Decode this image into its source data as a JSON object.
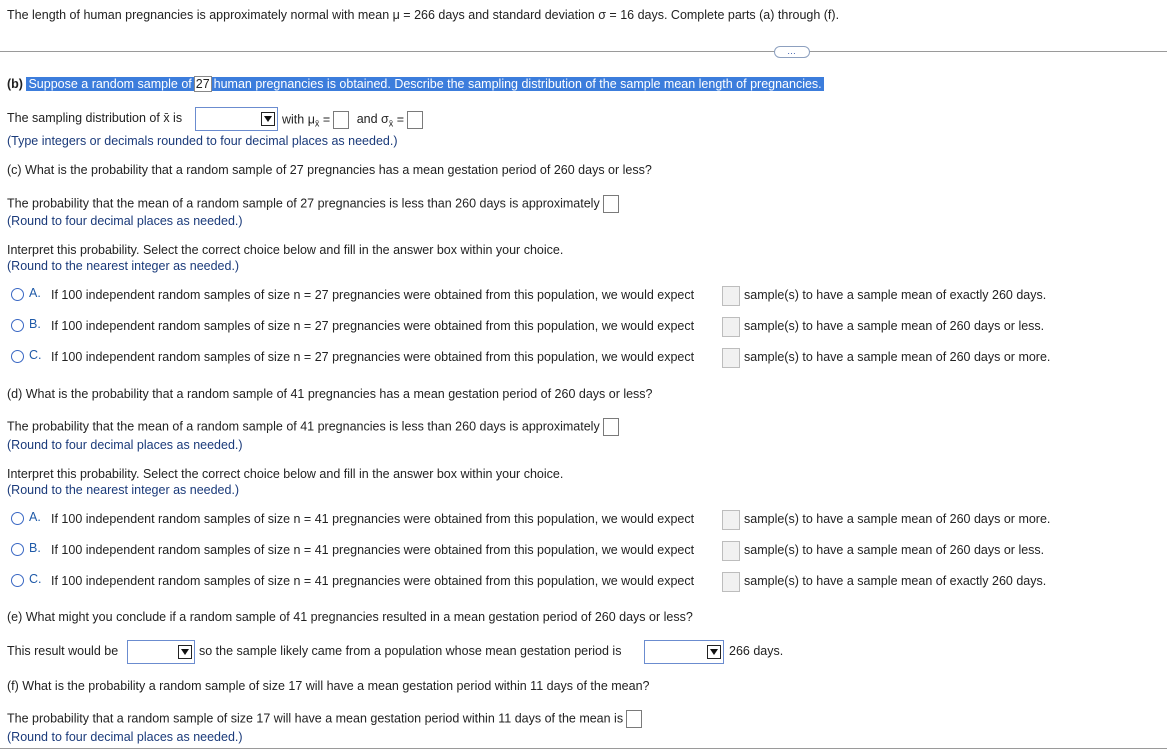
{
  "header": {
    "text": "The length of human pregnancies is approximately normal with mean μ = 266 days and standard deviation σ = 16 days. Complete parts (a) through (f)."
  },
  "more_button": {
    "label": "…"
  },
  "part_b": {
    "label": "(b)",
    "q1": "Suppose a random sample of",
    "n": "27",
    "q2": "human pregnancies is obtained. Describe the sampling distribution of the sample mean length of pregnancies.",
    "line_prefix": "The sampling distribution of x̄ is",
    "with_mu": "with μ",
    "x_bar_sub": "x̄",
    "equals": "=",
    "and_sigma": "and σ",
    "note": "(Type integers or decimals rounded to four decimal places as needed.)"
  },
  "part_c": {
    "question": "(c) What is the probability that a random sample of 27 pregnancies has a mean gestation period of 260 days or less?",
    "answer_text": "The probability that the mean of a random sample of 27 pregnancies is less than 260 days is approximately",
    "note": "(Round to four decimal places as needed.)",
    "interpret": "Interpret this probability. Select the correct choice below and fill in the answer box within your choice.",
    "interpret_note": "(Round to the nearest integer as needed.)",
    "options": [
      {
        "letter": "A.",
        "text": "If 100 independent random samples of size n = 27 pregnancies were obtained from this population, we would expect",
        "suffix": "sample(s) to have a sample mean of exactly 260 days."
      },
      {
        "letter": "B.",
        "text": "If 100 independent random samples of size n = 27 pregnancies were obtained from this population, we would expect",
        "suffix": "sample(s) to have a sample mean of 260 days or less."
      },
      {
        "letter": "C.",
        "text": "If 100 independent random samples of size n = 27 pregnancies were obtained from this population, we would expect",
        "suffix": "sample(s) to have a sample mean of 260 days or more."
      }
    ]
  },
  "part_d": {
    "question": "(d) What is the probability that a random sample of 41 pregnancies has a mean gestation period of 260 days or less?",
    "answer_text": "The probability that the mean of a random sample of 41 pregnancies is less than 260 days is approximately",
    "note": "(Round to four decimal places as needed.)",
    "interpret": "Interpret this probability. Select the correct choice below and fill in the answer box within your choice.",
    "interpret_note": "(Round to the nearest integer as needed.)",
    "options": [
      {
        "letter": "A.",
        "text": "If 100 independent random samples of size n = 41 pregnancies were obtained from this population, we would expect",
        "suffix": "sample(s) to have a sample mean of 260 days or more."
      },
      {
        "letter": "B.",
        "text": "If 100 independent random samples of size n = 41 pregnancies were obtained from this population, we would expect",
        "suffix": "sample(s) to have a sample mean of 260 days or less."
      },
      {
        "letter": "C.",
        "text": "If 100 independent random samples of size n = 41 pregnancies were obtained from this population, we would expect",
        "suffix": "sample(s) to have a sample mean of exactly 260 days."
      }
    ]
  },
  "part_e": {
    "question": "(e) What might you conclude if a random sample of 41 pregnancies resulted in a mean gestation period of 260 days or less?",
    "prefix": "This result would be",
    "middle": "so the sample likely came from a population whose mean gestation period is",
    "suffix": "266 days."
  },
  "part_f": {
    "question": "(f) What is the probability a random sample of size 17 will have a mean gestation period within 11 days of the mean?",
    "answer_text": "The probability that a random sample of size 17 will have a mean gestation period within 11 days of the mean is",
    "note": "(Round to four decimal places as needed.)"
  }
}
